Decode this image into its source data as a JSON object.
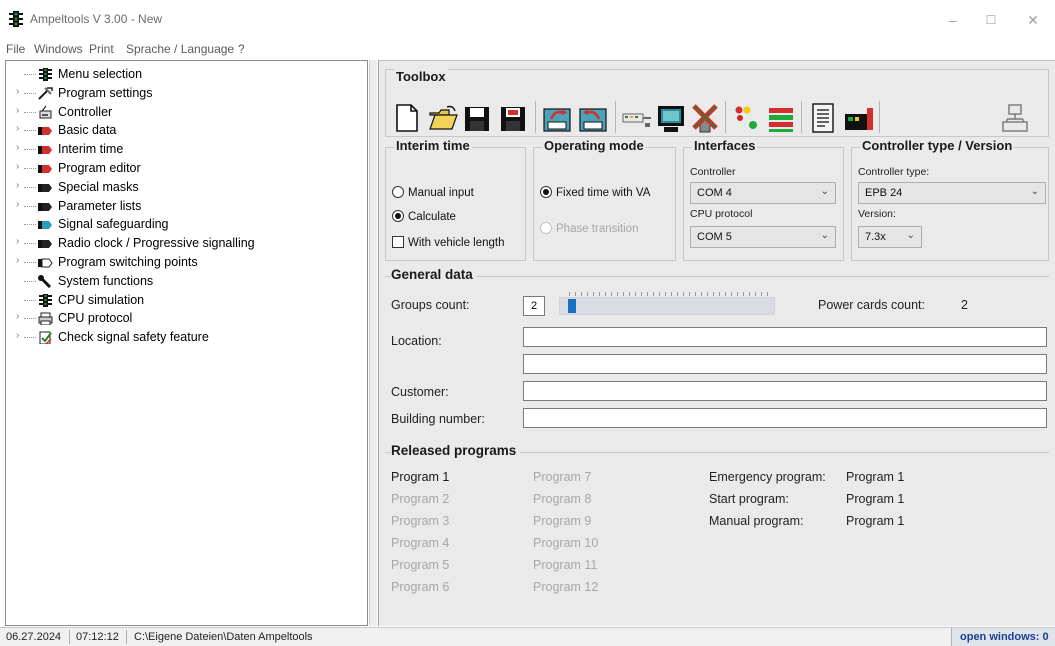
{
  "window": {
    "title": "Ampeltools V 3.00 - New",
    "minimize": "–",
    "maximize": "☐",
    "close": "✕"
  },
  "menu": [
    "File",
    "Windows",
    "Print",
    "Sprache / Language",
    "?"
  ],
  "tree": [
    {
      "label": "Menu selection",
      "icon": "traffic-light-icon",
      "expandable": false
    },
    {
      "label": "Program settings",
      "icon": "tools-icon",
      "expandable": true
    },
    {
      "label": "Controller",
      "icon": "controller-icon",
      "expandable": true
    },
    {
      "label": "Basic data",
      "icon": "red-pointer-icon",
      "expandable": true
    },
    {
      "label": "Interim time",
      "icon": "red-pointer-icon",
      "expandable": true
    },
    {
      "label": "Program editor",
      "icon": "red-pointer-icon",
      "expandable": true
    },
    {
      "label": "Special masks",
      "icon": "black-pointer-icon",
      "expandable": true
    },
    {
      "label": "Parameter lists",
      "icon": "black-pointer-icon",
      "expandable": true
    },
    {
      "label": "Signal safeguarding",
      "icon": "blue-pointer-icon",
      "expandable": false
    },
    {
      "label": "Radio clock / Progressive signalling",
      "icon": "black-pointer-icon",
      "expandable": true
    },
    {
      "label": "Program switching points",
      "icon": "outline-pointer-icon",
      "expandable": true
    },
    {
      "label": "System functions",
      "icon": "wrench-icon",
      "expandable": false
    },
    {
      "label": "CPU simulation",
      "icon": "traffic-light-icon",
      "expandable": false
    },
    {
      "label": "CPU protocol",
      "icon": "printer-icon",
      "expandable": true
    },
    {
      "label": "Check signal safety feature",
      "icon": "check-doc-icon",
      "expandable": true
    }
  ],
  "toolbox": {
    "title": "Toolbox",
    "tools": [
      "new-file-icon",
      "open-folder-icon",
      "save-icon",
      "save-as-icon",
      "export-icon",
      "import-icon",
      "connection-icon",
      "monitor-icon",
      "delete-icon",
      "signals-icon",
      "color-bars-icon",
      "report-icon",
      "device-icon",
      "network-icon"
    ]
  },
  "interim_time": {
    "title": "Interim time",
    "manual_input": "Manual input",
    "calculate": "Calculate",
    "with_vehicle_length": "With vehicle length",
    "selected": "calculate",
    "vehicle_length_checked": false
  },
  "operating_mode": {
    "title": "Operating mode",
    "fixed_time": "Fixed time with VA",
    "phase_transition": "Phase transition",
    "selected": "fixed_time"
  },
  "interfaces": {
    "title": "Interfaces",
    "controller_label": "Controller",
    "controller_value": "COM 4",
    "cpu_protocol_label": "CPU protocol",
    "cpu_protocol_value": "COM 5"
  },
  "controller_type": {
    "title": "Controller type / Version",
    "type_label": "Controller type:",
    "type_value": "EPB 24",
    "version_label": "Version:",
    "version_value": "7.3x"
  },
  "general_data": {
    "title": "General data",
    "groups_count_label": "Groups count:",
    "groups_count_value": "2",
    "power_cards_label": "Power cards count:",
    "power_cards_value": "2",
    "location_label": "Location:",
    "location_value": "",
    "location_value_2": "",
    "customer_label": "Customer:",
    "customer_value": "",
    "building_label": "Building number:",
    "building_value": ""
  },
  "released_programs": {
    "title": "Released programs",
    "col1": [
      {
        "label": "Program 1",
        "active": true
      },
      {
        "label": "Program 2",
        "active": false
      },
      {
        "label": "Program 3",
        "active": false
      },
      {
        "label": "Program 4",
        "active": false
      },
      {
        "label": "Program 5",
        "active": false
      },
      {
        "label": "Program 6",
        "active": false
      }
    ],
    "col2": [
      {
        "label": "Program 7",
        "active": false
      },
      {
        "label": "Program 8",
        "active": false
      },
      {
        "label": "Program 9",
        "active": false
      },
      {
        "label": "Program 10",
        "active": false
      },
      {
        "label": "Program 11",
        "active": false
      },
      {
        "label": "Program 12",
        "active": false
      }
    ],
    "emergency_label": "Emergency program:",
    "emergency_value": "Program 1",
    "start_label": "Start program:",
    "start_value": "Program 1",
    "manual_label": "Manual program:",
    "manual_value": "Program 1"
  },
  "status": {
    "date": "06.27.2024",
    "time": "07:12:12",
    "path": "C:\\Eigene Dateien\\Daten Ampeltools",
    "open_windows": "open windows: 0"
  },
  "colors": {
    "accent_blue": "#1a6fc1",
    "status_text": "#1f3f95",
    "disabled_text": "#a8a8a8"
  }
}
